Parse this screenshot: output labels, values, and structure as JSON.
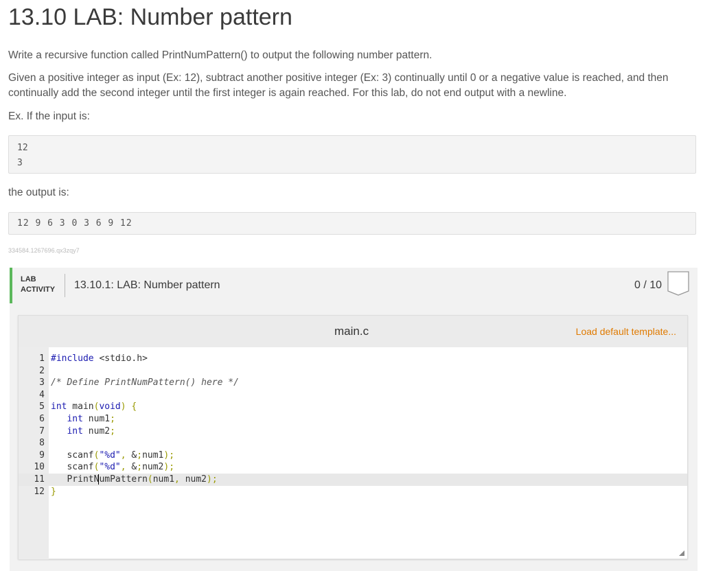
{
  "page": {
    "title": "13.10 LAB: Number pattern",
    "paragraph1": "Write a recursive function called PrintNumPattern() to output the following number pattern.",
    "paragraph2": "Given a positive integer as input (Ex: 12), subtract another positive integer (Ex: 3) continually until 0 or a negative value is reached, and then continually add the second integer until the first integer is again reached. For this lab, do not end output with a newline.",
    "paragraph3": "Ex. If the input is:",
    "sample_input": [
      "12",
      "3"
    ],
    "paragraph4": "the output is:",
    "sample_output": "12 9 6 3 0 3 6 9 12",
    "hash_id": "334584.1267696.qx3zqy7"
  },
  "lab": {
    "label_line1": "LAB",
    "label_line2": "ACTIVITY",
    "title": "13.10.1: LAB: Number pattern",
    "score": "0 / 10",
    "accent_color": "#5cb85c"
  },
  "editor": {
    "file_name": "main.c",
    "load_template_label": "Load default template...",
    "line_numbers": [
      "1",
      "2",
      "3",
      "4",
      "5",
      "6",
      "7",
      "8",
      "9",
      "10",
      "11",
      "12"
    ],
    "active_line": 11,
    "code_lines": [
      "#include <stdio.h>",
      "",
      "/* Define PrintNumPattern() here */",
      "",
      "int main(void) {",
      "   int num1;",
      "   int num2;",
      "",
      "   scanf(\"%d\", &num1);",
      "   scanf(\"%d\", &num2);",
      "   PrintNumPattern(num1, num2);",
      "}"
    ]
  }
}
